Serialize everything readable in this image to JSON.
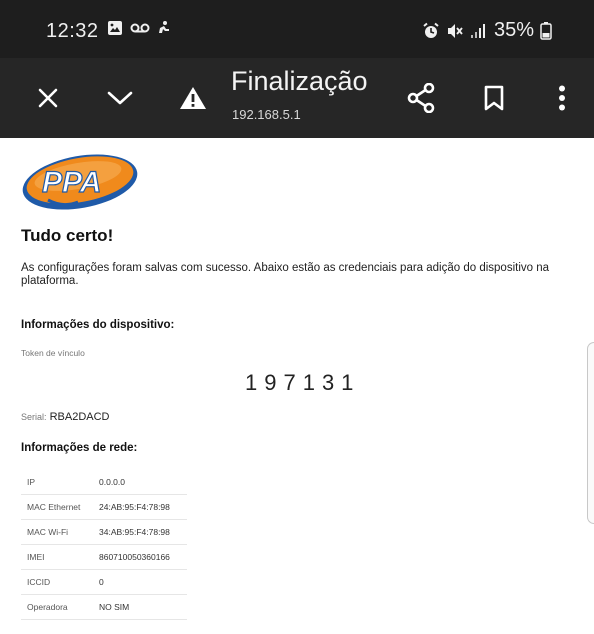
{
  "status_bar": {
    "time": "12:32",
    "battery": "35%",
    "icons": [
      "image-icon",
      "voicemail-icon",
      "accessibility-icon",
      "alarm-icon",
      "mute-icon",
      "signal-icon",
      "battery-icon"
    ]
  },
  "toolbar": {
    "title": "Finalização",
    "url": "192.168.5.1",
    "icons": [
      "close-icon",
      "chevron-down-icon",
      "warning-icon",
      "share-icon",
      "bookmark-icon",
      "more-vert-icon"
    ]
  },
  "page": {
    "logo_text": "PPA",
    "heading": "Tudo certo!",
    "message": "As configurações foram salvas com sucesso. Abaixo estão as credenciais para adição do dispositivo na plataforma.",
    "device_section_title": "Informações do dispositivo:",
    "token_label": "Token de vínculo",
    "token_value": "197131",
    "serial_label": "Serial:",
    "serial_value": "RBA2DACD",
    "network_section_title": "Informações de rede:",
    "network_rows": [
      {
        "key": "IP",
        "value": "0.0.0.0"
      },
      {
        "key": "MAC Ethernet",
        "value": "24:AB:95:F4:78:98"
      },
      {
        "key": "MAC Wi-Fi",
        "value": "34:AB:95:F4:78:98"
      },
      {
        "key": "IMEI",
        "value": "860710050360166"
      },
      {
        "key": "ICCID",
        "value": "0"
      },
      {
        "key": "Operadora",
        "value": "NO SIM"
      }
    ]
  },
  "colors": {
    "status_bg": "#1e1e1e",
    "toolbar_bg": "#262626",
    "logo_orange": "#f08a1c",
    "logo_blue": "#1f5aa8"
  }
}
